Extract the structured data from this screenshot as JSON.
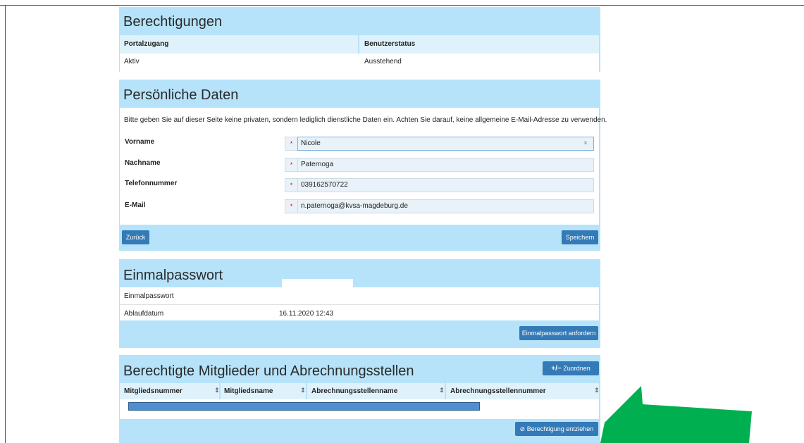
{
  "berechtigungen": {
    "title": "Berechtigungen",
    "columns": [
      "Portalzugang",
      "Benutzerstatus"
    ],
    "row": [
      "Aktiv",
      "Ausstehend"
    ]
  },
  "persoenliche_daten": {
    "title": "Persönliche Daten",
    "info": "Bitte geben Sie auf dieser Seite keine privaten, sondern lediglich dienstliche Daten ein. Achten Sie darauf, keine allgemeine E-Mail-Adresse zu verwenden.",
    "required_marker": "*",
    "fields": [
      {
        "label": "Vorname",
        "value": "Nicole"
      },
      {
        "label": "Nachname",
        "value": "Paternoga"
      },
      {
        "label": "Telefonnummer",
        "value": "039162570722"
      },
      {
        "label": "E-Mail",
        "value": "n.paternoga@kvsa-magdeburg.de"
      }
    ],
    "clear_symbol": "×",
    "back_label": "Zurück",
    "save_label": "Speichern"
  },
  "einmalpasswort": {
    "title": "Einmalpasswort",
    "row1_label": "Einmalpasswort",
    "row2_label": "Ablaufdatum",
    "row2_value": "16.11.2020 12:43",
    "request_label": "Einmalpasswort anfordern"
  },
  "mitglieder": {
    "title": "Berechtigte Mitglieder und Abrechnungsstellen",
    "assign_icon": "+/−",
    "assign_label": "Zuordnen",
    "columns": [
      "Mitgliedsnummer",
      "Mitgliedsname",
      "Abrechnungsstellenname",
      "Abrechnungsstellennummer"
    ],
    "sort_icon": "⇕",
    "revoke_icon": "⊘",
    "revoke_label": "Berechtigung entziehen"
  },
  "colors": {
    "panel": "#b6e3f9",
    "button": "#337ab7",
    "arrow": "#00b050",
    "redaction": "#4f8fd0"
  }
}
